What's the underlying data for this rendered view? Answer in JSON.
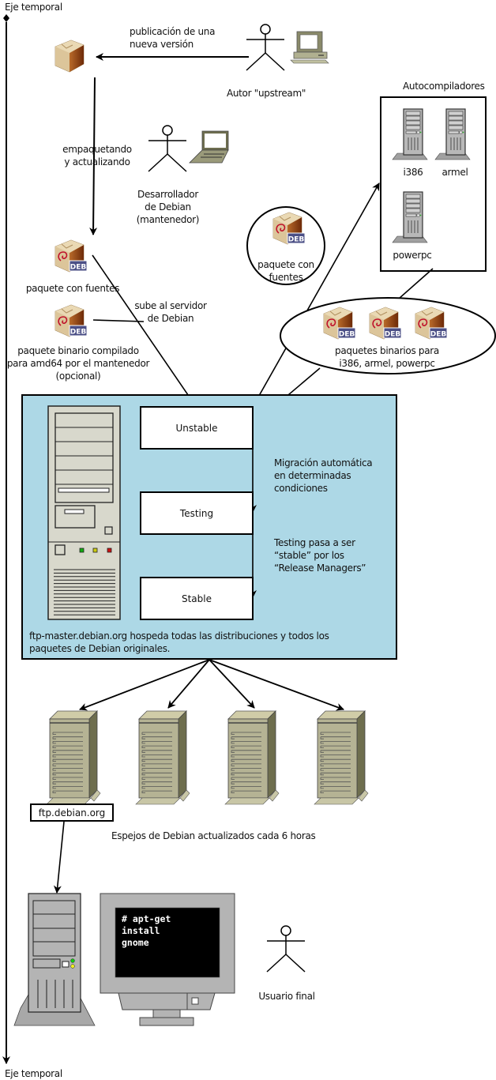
{
  "timeline": {
    "top_label": "Eje temporal",
    "bottom_label": "Eje temporal"
  },
  "upstream": {
    "author_label": "Autor \"upstream\"",
    "publish_label_line1": "publicación de una",
    "publish_label_line2": "nueva versión"
  },
  "maintainer": {
    "label_line1": "Desarrollador",
    "label_line2": "de Debian",
    "label_line3": "(mantenedor)",
    "packaging_line1": "empaquetando",
    "packaging_line2": "y actualizando"
  },
  "packages": {
    "source_label": "paquete con fuentes",
    "binary_line1": "paquete binario compilado",
    "binary_line2": "para amd64 por el mantenedor",
    "binary_line3": "(opcional)",
    "upload_line1": "sube al servidor",
    "upload_line2": "de Debian",
    "deb_badge": "DEB",
    "source_circle_line1": "paquete con",
    "source_circle_line2": "fuentes",
    "binaries_line1": "paquetes binarios para",
    "binaries_line2": "i386, armel, powerpc"
  },
  "autobuilders": {
    "title": "Autocompiladores",
    "arches": [
      "i386",
      "armel",
      "powerpc"
    ]
  },
  "ftp_master": {
    "distributions": [
      "Unstable",
      "Testing",
      "Stable"
    ],
    "migration_line1": "Migración automática",
    "migration_line2": "en determinadas",
    "migration_line3": "condiciones",
    "release_line1": "Testing pasa a ser",
    "release_line2": "“stable” por los",
    "release_line3": "“Release Managers”",
    "caption_line1": "ftp-master.debian.org hospeda todas las distribuciones y todos los",
    "caption_line2": "paquetes de Debian originales.",
    "bg_color": "#add8e6"
  },
  "mirrors": {
    "count": 4,
    "primary_label": "ftp.debian.org",
    "caption": "Espejos de Debian actualizados cada 6 horas"
  },
  "end_user": {
    "command_line1": "# apt-get install",
    "command_line2": "gnome",
    "label": "Usuario final"
  }
}
